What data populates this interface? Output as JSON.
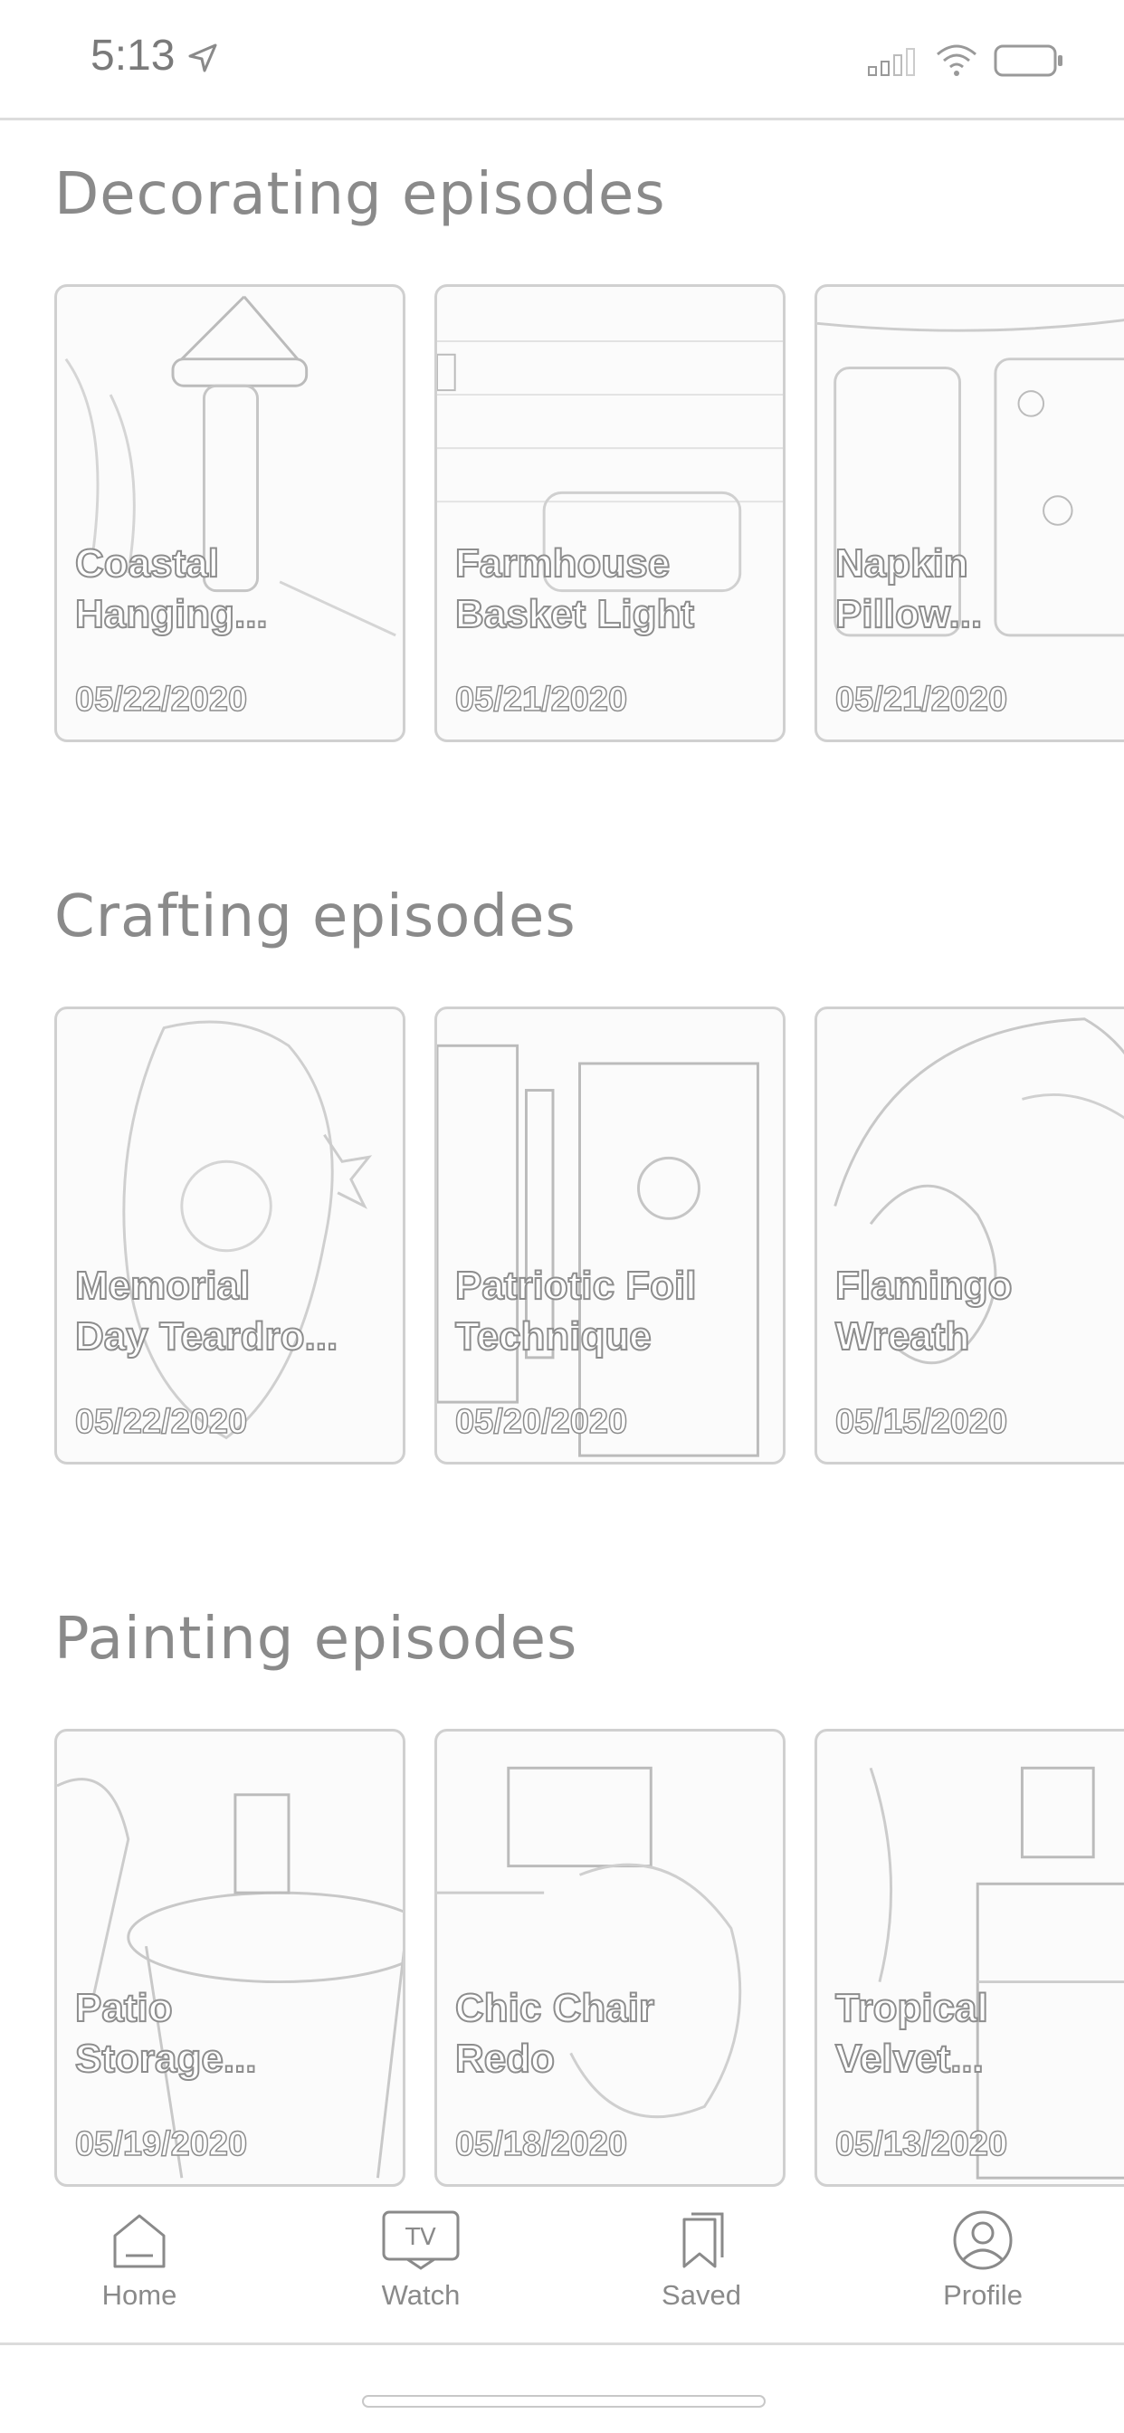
{
  "status_bar": {
    "time": "5:13"
  },
  "sections": [
    {
      "title": "Decorating episodes",
      "cards": [
        {
          "title": "Coastal\nHanging...",
          "date": "05/22/2020"
        },
        {
          "title": "Farmhouse\nBasket Light",
          "date": "05/21/2020"
        },
        {
          "title": "Napkin\nPillow...",
          "date": "05/21/2020"
        }
      ]
    },
    {
      "title": "Crafting episodes",
      "cards": [
        {
          "title": "Memorial\nDay Teardro...",
          "date": "05/22/2020"
        },
        {
          "title": "Patriotic Foil\nTechnique",
          "date": "05/20/2020"
        },
        {
          "title": "Flamingo\nWreath",
          "date": "05/15/2020"
        }
      ]
    },
    {
      "title": "Painting episodes",
      "cards": [
        {
          "title": "Patio\nStorage...",
          "date": "05/19/2020"
        },
        {
          "title": "Chic Chair\nRedo",
          "date": "05/18/2020"
        },
        {
          "title": "Tropical\nVelvet...",
          "date": "05/13/2020"
        }
      ]
    }
  ],
  "tab_bar": {
    "items": [
      {
        "label": "Home",
        "icon": "home-icon"
      },
      {
        "label": "Watch",
        "icon": "tv-icon",
        "icon_text": "TV"
      },
      {
        "label": "Saved",
        "icon": "bookmark-icon"
      },
      {
        "label": "Profile",
        "icon": "profile-icon"
      }
    ]
  }
}
